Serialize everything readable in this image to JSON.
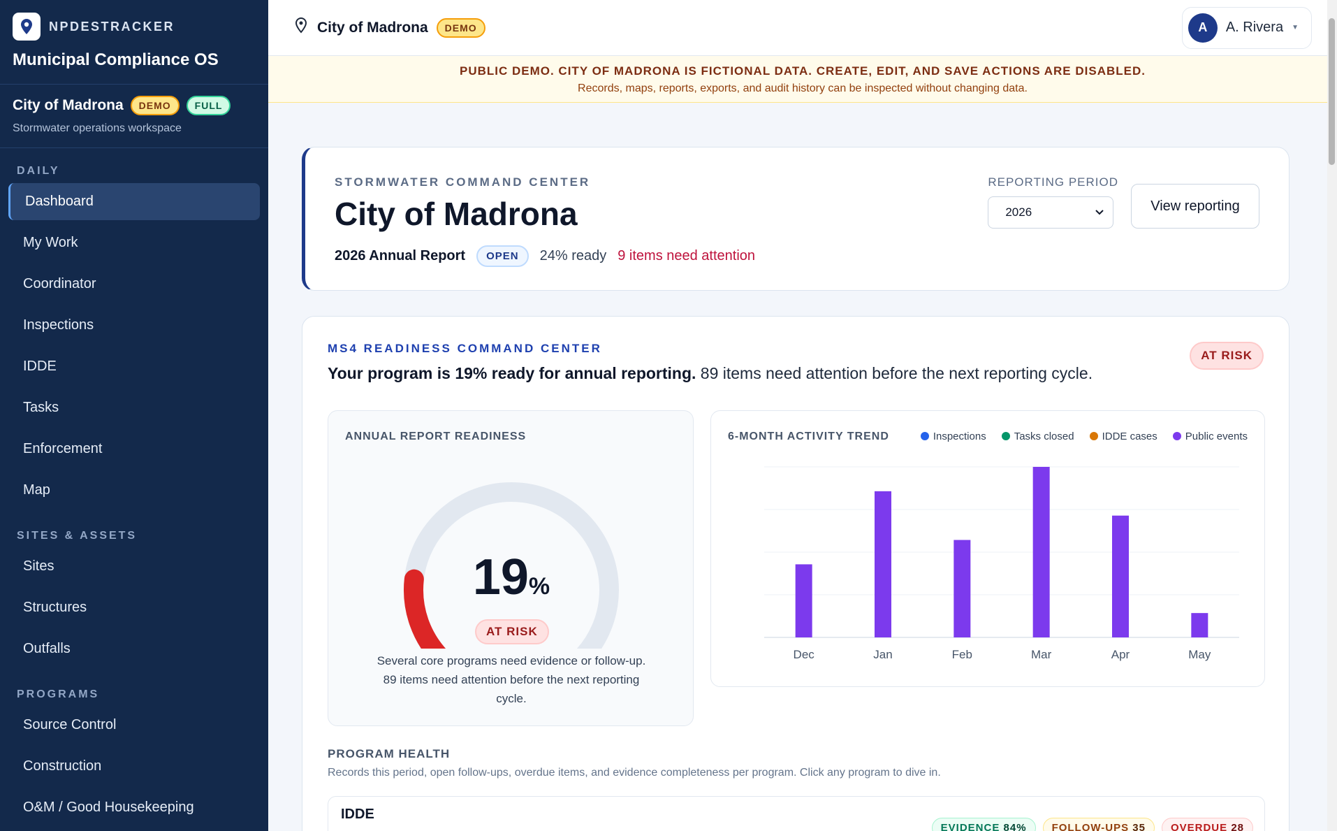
{
  "brand": {
    "name": "NPDESTRACKER",
    "product": "Municipal Compliance OS"
  },
  "tenant": {
    "name": "City of Madrona",
    "badge_demo": "DEMO",
    "badge_full": "FULL",
    "subtitle": "Stormwater operations workspace"
  },
  "nav": {
    "sections": [
      {
        "title": "DAILY",
        "items": [
          "Dashboard",
          "My Work",
          "Coordinator",
          "Inspections",
          "IDDE",
          "Tasks",
          "Enforcement",
          "Map"
        ]
      },
      {
        "title": "SITES & ASSETS",
        "items": [
          "Sites",
          "Structures",
          "Outfalls"
        ]
      },
      {
        "title": "PROGRAMS",
        "items": [
          "Source Control",
          "Construction",
          "O&M / Good Housekeeping"
        ]
      }
    ],
    "active": "Dashboard"
  },
  "topbar": {
    "title": "City of Madrona",
    "badge": "DEMO",
    "user_initial": "A",
    "user_name": "A. Rivera"
  },
  "banner": {
    "title": "PUBLIC DEMO. CITY OF MADRONA IS FICTIONAL DATA. CREATE, EDIT, AND SAVE ACTIONS ARE DISABLED.",
    "subtitle": "Records, maps, reports, exports, and audit history can be inspected without changing data."
  },
  "header": {
    "eyebrow": "STORMWATER COMMAND CENTER",
    "title": "City of Madrona",
    "report": "2026 Annual Report",
    "status": "OPEN",
    "ready": "24% ready",
    "attention": "9 items need attention",
    "period_label": "REPORTING PERIOD",
    "period_value": "2026",
    "view_button": "View reporting"
  },
  "readiness": {
    "eyebrow": "MS4 READINESS COMMAND CENTER",
    "headline_bold": "Your program is 19% ready for annual reporting.",
    "headline_rest": " 89 items need attention before the next reporting cycle.",
    "status": "AT RISK",
    "gauge": {
      "title": "ANNUAL REPORT READINESS",
      "value": 19,
      "value_text": "19",
      "unit": "%",
      "status": "AT RISK",
      "note": "Several core programs need evidence or follow-up. 89 items need attention before the next reporting cycle."
    },
    "trend": {
      "title": "6-MONTH ACTIVITY TREND",
      "legend": [
        {
          "label": "Inspections",
          "color": "#2563eb"
        },
        {
          "label": "Tasks closed",
          "color": "#059669"
        },
        {
          "label": "IDDE cases",
          "color": "#d97706"
        },
        {
          "label": "Public events",
          "color": "#7c3aed"
        }
      ]
    }
  },
  "chart_data": {
    "type": "bar",
    "categories": [
      "Dec",
      "Jan",
      "Feb",
      "Mar",
      "Apr",
      "May"
    ],
    "series": [
      {
        "name": "Public events",
        "values": [
          6,
          12,
          8,
          14,
          10,
          2
        ]
      }
    ],
    "ylim": [
      0,
      14
    ],
    "grid": true,
    "legend_position": "top-right"
  },
  "program_health": {
    "title": "PROGRAM HEALTH",
    "subtitle": "Records this period, open follow-ups, overdue items, and evidence completeness per program. Click any program to dive in.",
    "programs": [
      {
        "name": "IDDE",
        "evidence_label": "EVIDENCE",
        "evidence": "84%",
        "followups_label": "FOLLOW-UPS",
        "followups": "35",
        "overdue_label": "OVERDUE",
        "overdue": "28"
      }
    ]
  }
}
